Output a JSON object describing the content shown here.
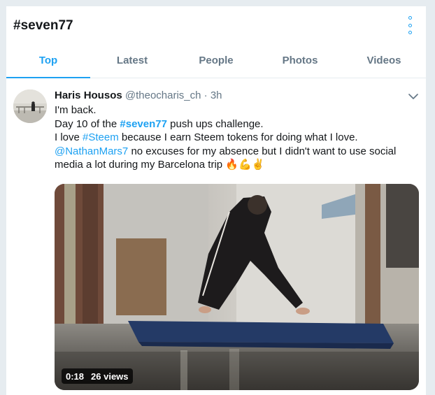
{
  "header": {
    "title": "#seven77"
  },
  "tabs": [
    {
      "label": "Top"
    },
    {
      "label": "Latest"
    },
    {
      "label": "People"
    },
    {
      "label": "Photos"
    },
    {
      "label": "Videos"
    }
  ],
  "tweet": {
    "display_name": "Haris Housos",
    "handle": "@theocharis_ch",
    "separator": "·",
    "time": "3h",
    "text": {
      "line1": "I'm back.",
      "line2_a": "Day 10 of the ",
      "line2_tag": "#seven77",
      "line2_b": " push ups challenge.",
      "line3_a": "I love ",
      "line3_tag": "#Steem",
      "line3_b": " because I earn Steem tokens for doing what I love.",
      "line4_mention": "@NathanMars7",
      "line4_b": " no excuses for my absence but I didn't want to use social",
      "line5": "media a lot during my Barcelona trip ",
      "emojis": "🔥💪✌"
    },
    "video": {
      "duration": "0:18",
      "views": "26 views"
    }
  },
  "colors": {
    "accent": "#1da1f2",
    "secondary_text": "#657786",
    "page_bg": "#e6ecf0"
  },
  "icons": {
    "more": "more-vertical-icon",
    "caret": "chevron-down-icon"
  }
}
